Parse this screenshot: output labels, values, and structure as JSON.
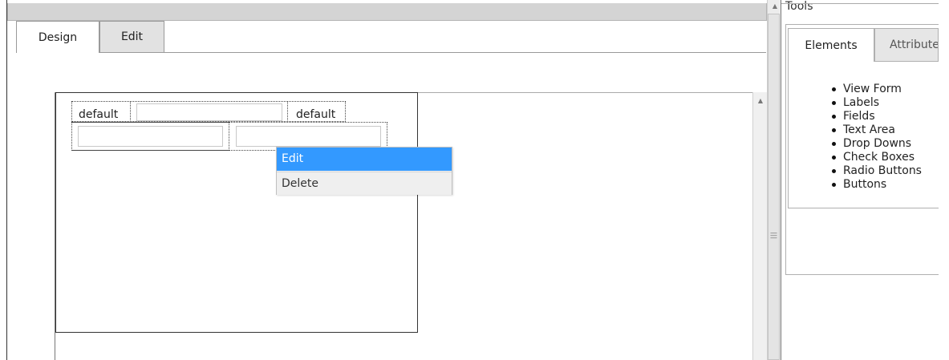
{
  "designer": {
    "tabs": [
      {
        "label": "Design",
        "active": true
      },
      {
        "label": "Edit",
        "active": false
      }
    ],
    "form_row1": {
      "label_left": "default",
      "input_middle_value": "",
      "label_right": "default"
    },
    "form_row2": {
      "input_left_value": "",
      "input_right_value": ""
    }
  },
  "context_menu": {
    "items": [
      {
        "label": "Edit",
        "highlighted": true
      },
      {
        "label": "Delete",
        "highlighted": false
      }
    ]
  },
  "tools": {
    "title": "Tools",
    "tabs": [
      {
        "label": "Elements",
        "active": true
      },
      {
        "label": "Attributes",
        "active": false
      }
    ],
    "elements": [
      "View Form",
      "Labels",
      "Fields",
      "Text Area",
      "Drop Downs",
      "Check Boxes",
      "Radio Buttons",
      "Buttons"
    ]
  },
  "colors": {
    "menu_highlight": "#3399ff",
    "top_bar": "#d4d4d4"
  }
}
